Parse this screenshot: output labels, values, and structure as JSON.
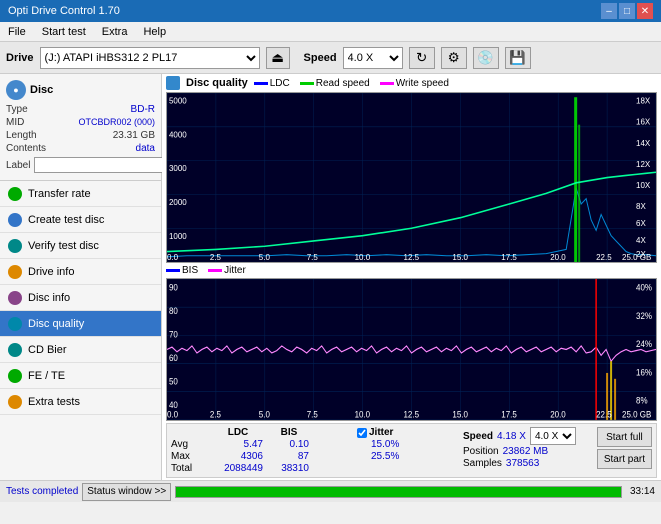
{
  "titlebar": {
    "title": "Opti Drive Control 1.70",
    "minimize": "–",
    "maximize": "□",
    "close": "✕"
  },
  "menubar": {
    "items": [
      "File",
      "Start test",
      "Extra",
      "Help"
    ]
  },
  "drivebar": {
    "drive_label": "Drive",
    "drive_value": "(J:) ATAPI iHBS312  2 PL17",
    "speed_label": "Speed",
    "speed_value": "4.0 X"
  },
  "disc": {
    "type_label": "Type",
    "type_value": "BD-R",
    "mid_label": "MID",
    "mid_value": "OTCBDR002 (000)",
    "length_label": "Length",
    "length_value": "23.31 GB",
    "contents_label": "Contents",
    "contents_value": "data",
    "label_label": "Label"
  },
  "sidebar": {
    "items": [
      {
        "id": "transfer-rate",
        "label": "Transfer rate",
        "color": "green"
      },
      {
        "id": "create-test-disc",
        "label": "Create test disc",
        "color": "blue"
      },
      {
        "id": "verify-test-disc",
        "label": "Verify test disc",
        "color": "teal"
      },
      {
        "id": "drive-info",
        "label": "Drive info",
        "color": "orange"
      },
      {
        "id": "disc-info",
        "label": "Disc info",
        "color": "purple"
      },
      {
        "id": "disc-quality",
        "label": "Disc quality",
        "color": "cyan",
        "active": true
      },
      {
        "id": "cd-bier",
        "label": "CD Bier",
        "color": "teal"
      },
      {
        "id": "fe-te",
        "label": "FE / TE",
        "color": "green"
      },
      {
        "id": "extra-tests",
        "label": "Extra tests",
        "color": "orange"
      }
    ]
  },
  "chart1": {
    "title": "Disc quality",
    "legend": [
      {
        "label": "LDC",
        "color": "#0000ff"
      },
      {
        "label": "Read speed",
        "color": "#00cc00"
      },
      {
        "label": "Write speed",
        "color": "#ff00ff"
      }
    ],
    "y_max": 5000,
    "y_min": 0,
    "x_max": 25,
    "y_right_max": 18,
    "y_right_labels": [
      "18X",
      "16X",
      "14X",
      "12X",
      "10X",
      "8X",
      "6X",
      "4X",
      "2X"
    ]
  },
  "chart2": {
    "legend": [
      {
        "label": "BIS",
        "color": "#0000ff"
      },
      {
        "label": "Jitter",
        "color": "#ff00ff"
      }
    ],
    "y_max": 90,
    "y_min": 10,
    "x_max": 25,
    "y_right_labels": [
      "40%",
      "32%",
      "24%",
      "16%",
      "8%"
    ]
  },
  "stats": {
    "ldc_label": "LDC",
    "bis_label": "BIS",
    "jitter_label": "Jitter",
    "speed_label": "Speed",
    "avg_label": "Avg",
    "max_label": "Max",
    "total_label": "Total",
    "avg_ldc": "5.47",
    "avg_bis": "0.10",
    "avg_jitter": "15.0%",
    "max_ldc": "4306",
    "max_bis": "87",
    "max_jitter": "25.5%",
    "total_ldc": "2088449",
    "total_bis": "38310",
    "speed_val": "4.18 X",
    "speed_dd": "4.0 X",
    "position_label": "Position",
    "position_val": "23862 MB",
    "samples_label": "Samples",
    "samples_val": "378563",
    "start_full": "Start full",
    "start_part": "Start part"
  },
  "statusbar": {
    "status_btn": "Status window >>",
    "progress": 100,
    "status_text": "Tests completed",
    "time": "33:14"
  }
}
